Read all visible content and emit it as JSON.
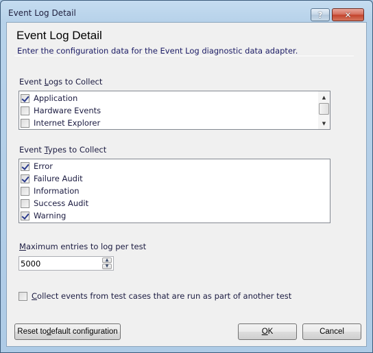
{
  "window": {
    "title": "Event Log Detail",
    "help_glyph": "?",
    "close_glyph": "✕"
  },
  "header": {
    "title": "Event Log Detail",
    "subtitle": "Enter the configuration data for the Event Log diagnostic data adapter."
  },
  "event_logs": {
    "label_pre": "Event ",
    "label_mnemonic": "L",
    "label_post": "ogs to Collect",
    "items": [
      {
        "label": "Application",
        "checked": true
      },
      {
        "label": "Hardware Events",
        "checked": false
      },
      {
        "label": "Internet Explorer",
        "checked": false
      }
    ],
    "scroll_up_glyph": "▲",
    "scroll_down_glyph": "▼"
  },
  "event_types": {
    "label_pre": "Event ",
    "label_mnemonic": "T",
    "label_post": "ypes to Collect",
    "items": [
      {
        "label": "Error",
        "checked": true
      },
      {
        "label": "Failure Audit",
        "checked": true
      },
      {
        "label": "Information",
        "checked": false
      },
      {
        "label": "Success Audit",
        "checked": false
      },
      {
        "label": "Warning",
        "checked": true
      }
    ]
  },
  "max_entries": {
    "label_mnemonic": "M",
    "label_post": "aximum entries to log per test",
    "value": "5000",
    "up_glyph": "▲",
    "down_glyph": "▼"
  },
  "collect_subtests": {
    "label_mnemonic": "C",
    "label_post": "ollect events from test cases that are run as part of another test",
    "checked": false
  },
  "buttons": {
    "reset_pre": "Reset to ",
    "reset_mnemonic": "d",
    "reset_post": "efault configuration",
    "ok_mnemonic": "O",
    "ok_post": "K",
    "cancel": "Cancel"
  }
}
